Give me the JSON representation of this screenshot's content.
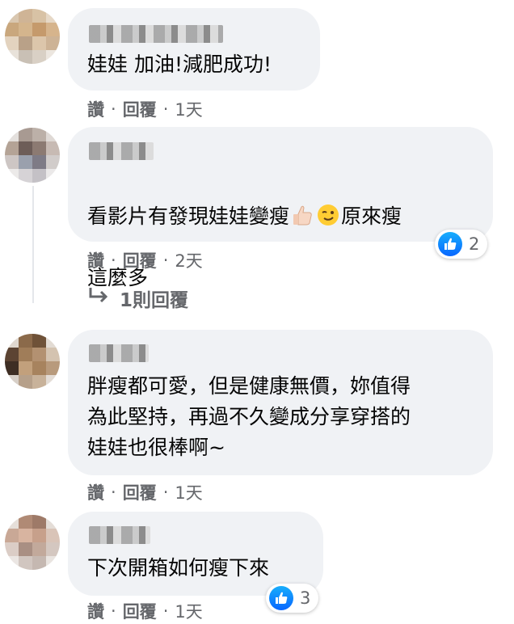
{
  "comments": [
    {
      "text": "娃娃 加油!減肥成功!",
      "actions": {
        "like": "讚",
        "reply": "回覆",
        "time": "1天"
      }
    },
    {
      "text_before": "看影片有發現娃娃變瘦",
      "emojis": [
        "thumbs-up-icon",
        "winking-face-icon"
      ],
      "text_after": "原來瘦",
      "text_line2": "這麼多",
      "actions": {
        "like": "讚",
        "reply": "回覆",
        "time": "2天"
      },
      "reaction": {
        "icon": "like-icon",
        "count": "2",
        "color": "#0866ff"
      },
      "replies_label": "1則回覆"
    },
    {
      "text": "胖瘦都可愛，但是健康無價，妳值得\n為此堅持，再過不久變成分享穿搭的\n娃娃也很棒啊~",
      "actions": {
        "like": "讚",
        "reply": "回覆",
        "time": "1天"
      }
    },
    {
      "text": "下次開箱如何瘦下來",
      "actions": {
        "like": "讚",
        "reply": "回覆",
        "time": "1天"
      },
      "reaction": {
        "icon": "like-icon",
        "count": "3",
        "color": "#0866ff"
      }
    }
  ],
  "colors": {
    "bubble": "#f0f2f5",
    "meta": "#65676b",
    "text": "#050505"
  }
}
